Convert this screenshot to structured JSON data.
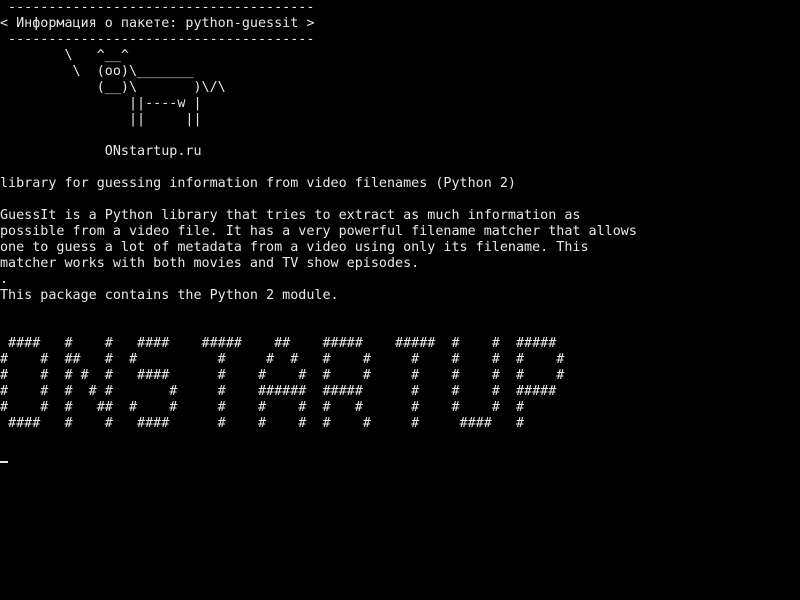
{
  "terminal": {
    "foreground": "#e8e8e8",
    "background": "#000000",
    "cursor_shape": "underscore",
    "lines": [
      " --------------------------------------",
      "< Информация о пакете: python-guessit >",
      " --------------------------------------",
      "        \\   ^__^",
      "         \\  (oo)\\_______",
      "            (__)\\       )\\/\\",
      "                ||----w |",
      "                ||     ||",
      "",
      "             ONstartup.ru",
      "",
      "library for guessing information from video filenames (Python 2)",
      "",
      "GuessIt is a Python library that tries to extract as much information as",
      "possible from a video file. It has a very powerful filename matcher that allows",
      "one to guess a lot of metadata from a video using only its filename. This",
      "matcher works with both movies and TV show episodes.",
      ".",
      "This package contains the Python 2 module.",
      "",
      "",
      " ####   #    #   ####    #####    ##    #####    #####  #    #  #####",
      "#    #  ##   #  #          #     #  #   #    #     #    #    #  #    #",
      "#    #  # #  #   ####      #    #    #  #    #     #    #    #  #    #",
      "#    #  #  # #       #     #    ######  #####      #    #    #  #####",
      "#    #  #   ##  #    #     #    #    #  #   #      #    #    #  #",
      " ####   #    #   ####      #    #    #  #    #     #     ####   #"
    ]
  }
}
